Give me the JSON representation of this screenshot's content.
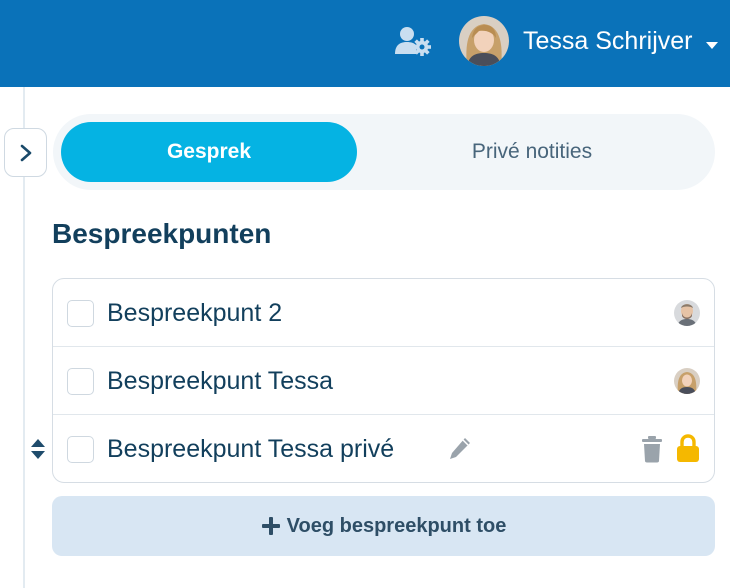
{
  "header": {
    "user_name": "Tessa Schrijver",
    "icons": {
      "user_settings": "user-gear-icon",
      "dropdown": "caret-down-icon"
    },
    "colors": {
      "bar": "#0a72b9"
    }
  },
  "tabs": [
    {
      "label": "Gesprek",
      "active": true
    },
    {
      "label": "Privé notities",
      "active": false
    }
  ],
  "section": {
    "title": "Bespreekpunten"
  },
  "items": [
    {
      "label": "Bespreekpunt 2",
      "avatar": "male-avatar"
    },
    {
      "label": "Bespreekpunt Tessa",
      "avatar": "tessa-avatar"
    },
    {
      "label": "Bespreekpunt Tessa privé",
      "icons": [
        "pencil-icon",
        "trash-icon",
        "lock-icon"
      ]
    }
  ],
  "add_button": {
    "label": "Voeg bespreekpunt toe"
  },
  "colors": {
    "accent": "#05b3e3",
    "lock": "#f5b800",
    "text": "#123f5c"
  }
}
